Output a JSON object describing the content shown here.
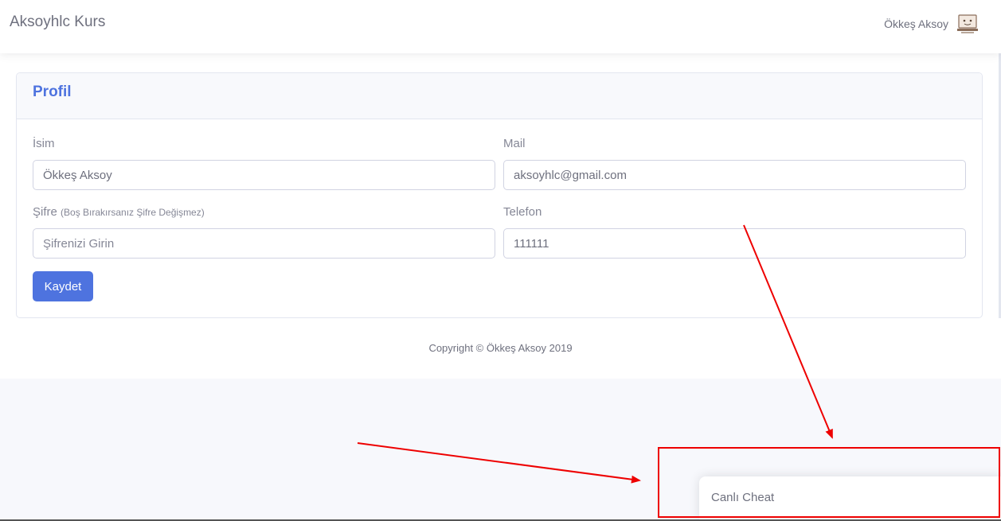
{
  "topbar": {
    "brand": "Aksoyhlc Kurs",
    "user_name": "Ökkeş Aksoy",
    "avatar_icon": "avatar-icon"
  },
  "card": {
    "title": "Profil",
    "fields": {
      "name": {
        "label": "İsim",
        "value": "Ökkeş Aksoy"
      },
      "mail": {
        "label": "Mail",
        "value": "aksoyhlc@gmail.com"
      },
      "password": {
        "label": "Şifre",
        "hint": "(Boş Bırakırsanız Şifre Değişmez)",
        "placeholder": "Şifrenizi Girin",
        "value": ""
      },
      "phone": {
        "label": "Telefon",
        "value": "111111"
      }
    },
    "save_label": "Kaydet"
  },
  "footer": {
    "copyright": "Copyright © Ökkeş Aksoy 2019"
  },
  "chat": {
    "title": "Canlı Cheat"
  },
  "colors": {
    "primary": "#4e73df",
    "annotation": "#ee0000"
  }
}
